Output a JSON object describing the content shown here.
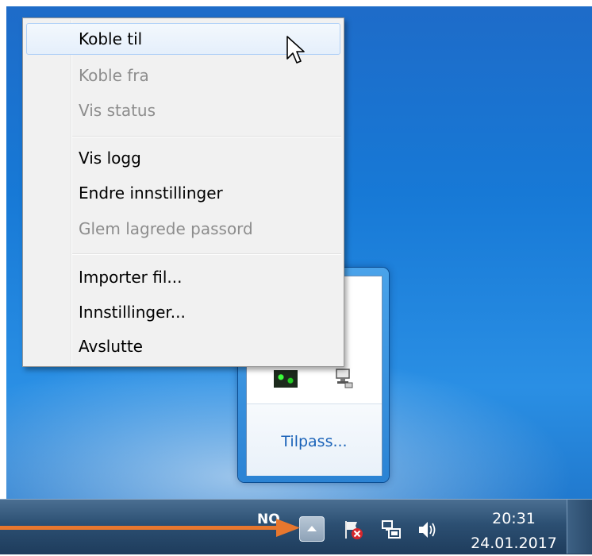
{
  "menu": {
    "items": [
      {
        "label": "Koble til",
        "enabled": true,
        "hovered": true
      },
      {
        "label": "Koble fra",
        "enabled": false
      },
      {
        "label": "Vis status",
        "enabled": false
      },
      {
        "label": "Vis logg",
        "enabled": true
      },
      {
        "label": "Endre innstillinger",
        "enabled": true
      },
      {
        "label": "Glem lagrede passord",
        "enabled": false
      },
      {
        "label": "Importer fil...",
        "enabled": true
      },
      {
        "label": "Innstillinger...",
        "enabled": true
      },
      {
        "label": "Avslutte",
        "enabled": true
      }
    ]
  },
  "flyout": {
    "customize_label": "Tilpass...",
    "icons": [
      "openvpn-gui-icon",
      "network-tray-icon"
    ]
  },
  "taskbar": {
    "language": "NO",
    "show_hidden_icons": "chevron-up-icon",
    "tray_icons": [
      "action-center-flag-icon",
      "network-icon",
      "volume-icon"
    ],
    "time": "20:31",
    "date": "24.01.2017"
  },
  "colors": {
    "accent": "#1a62b8",
    "annotation_arrow": "#e8772e",
    "desktop_blue": "#1779d6"
  }
}
